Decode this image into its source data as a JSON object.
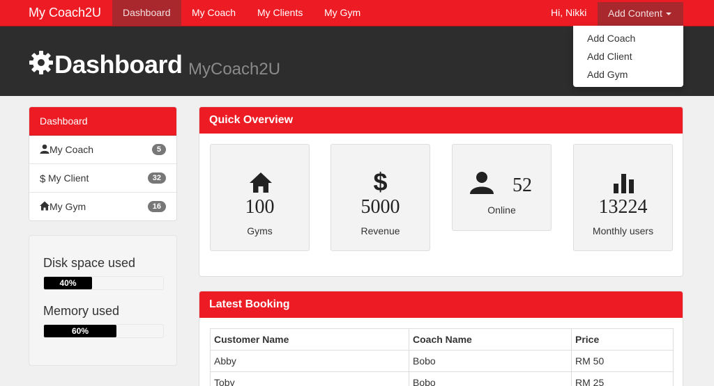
{
  "navbar": {
    "brand": "My Coach2U",
    "links": [
      "Dashboard",
      "My Coach",
      "My Clients",
      "My Gym"
    ],
    "greeting": "Hi, Nikki",
    "add_content": "Add Content"
  },
  "dropdown": {
    "items": [
      "Add Coach",
      "Add Client",
      "Add Gym"
    ]
  },
  "header": {
    "title": "Dashboard",
    "subtitle": "MyCoach2U"
  },
  "sidebar": {
    "heading": "Dashboard",
    "items": [
      {
        "label": "My Coach",
        "count": "5",
        "icon": "user-icon"
      },
      {
        "label": "My Client",
        "count": "32",
        "icon": "dollar-icon"
      },
      {
        "label": "My Gym",
        "count": "16",
        "icon": "home-icon"
      }
    ]
  },
  "usage": {
    "disk_label": "Disk space used",
    "disk_value": "40%",
    "disk_fraction": 0.4,
    "memory_label": "Memory used",
    "memory_value": "60%",
    "memory_fraction": 0.6
  },
  "overview": {
    "title": "Quick Overview",
    "tiles": [
      {
        "icon": "home-icon",
        "value": "100",
        "label": "Gyms"
      },
      {
        "icon": "dollar-icon",
        "value": "5000",
        "label": "Revenue"
      },
      {
        "icon": "user-icon",
        "value": "52",
        "label": "Online"
      },
      {
        "icon": "stats-icon",
        "value": "13224",
        "label": "Monthly users"
      }
    ]
  },
  "booking": {
    "title": "Latest Booking",
    "columns": [
      "Customer Name",
      "Coach Name",
      "Price"
    ],
    "rows": [
      [
        "Abby",
        "Bobo",
        "RM 50"
      ],
      [
        "Toby",
        "Bobo",
        "RM 25"
      ]
    ]
  },
  "colors": {
    "brand_red": "#ed1c24",
    "active_red": "#a8282d",
    "header_dark": "#2d2d2d"
  }
}
